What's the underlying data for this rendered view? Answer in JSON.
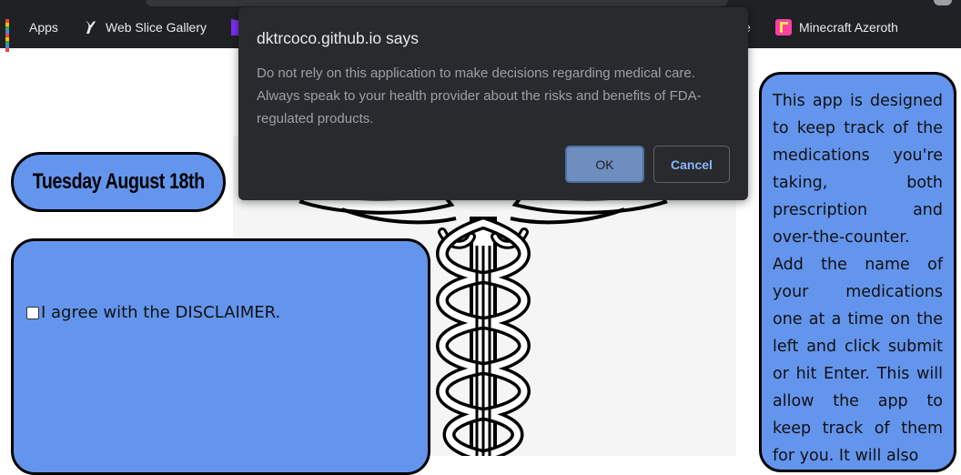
{
  "bookmarks": {
    "items": [
      {
        "label": "Apps",
        "icon": "apps-grid-icon"
      },
      {
        "label": "Web Slice Gallery",
        "icon": "web-slice-icon"
      },
      {
        "label": "le",
        "icon": "bookmark-icon"
      },
      {
        "label": "Minecraft Azeroth",
        "icon": "minecraft-icon"
      }
    ]
  },
  "page": {
    "date": "Tuesday August 18th",
    "disclaimer_checkbox_label": "I agree with the DISCLAIMER.",
    "disclaimer_checked": false,
    "info_text": "This app is designed to keep track of the medications you're taking, both prescription and over-the-counter. Add the name of your medications one at a time on the left and click submit or hit Enter. This will allow the app to keep track of them for you. It will also",
    "logo": "caduceus-icon"
  },
  "dialog": {
    "title": "dktrcoco.github.io says",
    "message": "Do not rely on this application to make decisions regarding medical care. Always speak to your health provider about the risks and benefits of FDA-regulated products.",
    "ok_label": "OK",
    "cancel_label": "Cancel"
  },
  "colors": {
    "panel_blue": "#6495ed",
    "dialog_bg": "#292a2d",
    "bookmarks_bg": "#202124",
    "ok_button": "#6d8ebf",
    "cancel_text": "#8ab4f8"
  }
}
